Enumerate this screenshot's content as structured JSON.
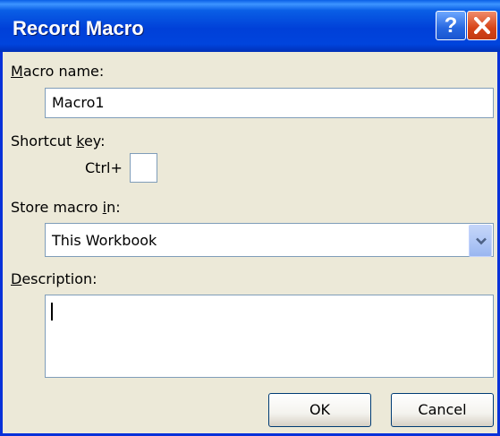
{
  "dialog": {
    "title": "Record Macro",
    "help_button": "?"
  },
  "macro_name": {
    "label_accel": "M",
    "label_rest": "acro name:",
    "value": "Macro1"
  },
  "shortcut": {
    "label_pre": "Shortcut ",
    "label_accel": "k",
    "label_post": "ey:",
    "prefix": "Ctrl+",
    "value": ""
  },
  "store_in": {
    "label_pre": "Store macro ",
    "label_accel": "i",
    "label_post": "n:",
    "selected": "This Workbook"
  },
  "description": {
    "label_accel": "D",
    "label_rest": "escription:",
    "value": ""
  },
  "buttons": {
    "ok": "OK",
    "cancel": "Cancel"
  },
  "colors": {
    "title_bar": "#0a5fe6",
    "close_button": "#d64418",
    "dialog_bg": "#ece9d8"
  }
}
